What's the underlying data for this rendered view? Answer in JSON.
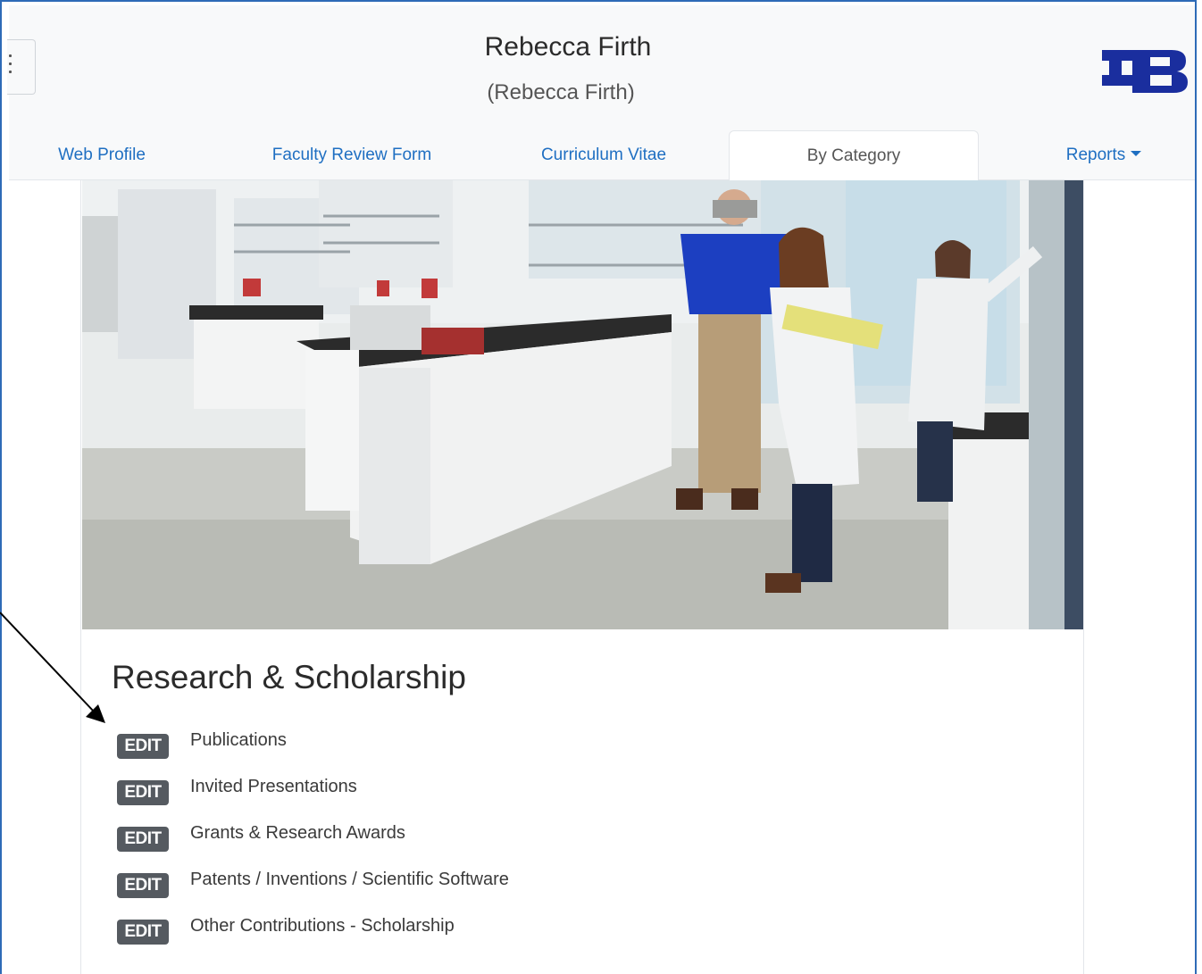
{
  "header": {
    "name": "Rebecca Firth",
    "subname": "(Rebecca Firth)"
  },
  "nav": {
    "tabs": [
      {
        "label": "Web Profile"
      },
      {
        "label": "Faculty Review Form"
      },
      {
        "label": "Curriculum Vitae"
      },
      {
        "label": "By Category"
      },
      {
        "label": "Reports"
      }
    ],
    "active": "By Category"
  },
  "section": {
    "title": "Research & Scholarship",
    "edit_label": "EDIT",
    "items": [
      {
        "label": "Publications"
      },
      {
        "label": "Invited Presentations"
      },
      {
        "label": "Grants & Research Awards"
      },
      {
        "label": "Patents / Inventions / Scientific Software"
      },
      {
        "label": "Other Contributions - Scholarship"
      }
    ]
  },
  "colors": {
    "link": "#1f6fc2",
    "brand": "#1a2e9e",
    "badge": "#555a60",
    "frame": "#2e6bb7"
  },
  "icons": {
    "menu": "vertical-dots-icon",
    "logo": "ub-logo",
    "annotation": "arrow-icon"
  }
}
